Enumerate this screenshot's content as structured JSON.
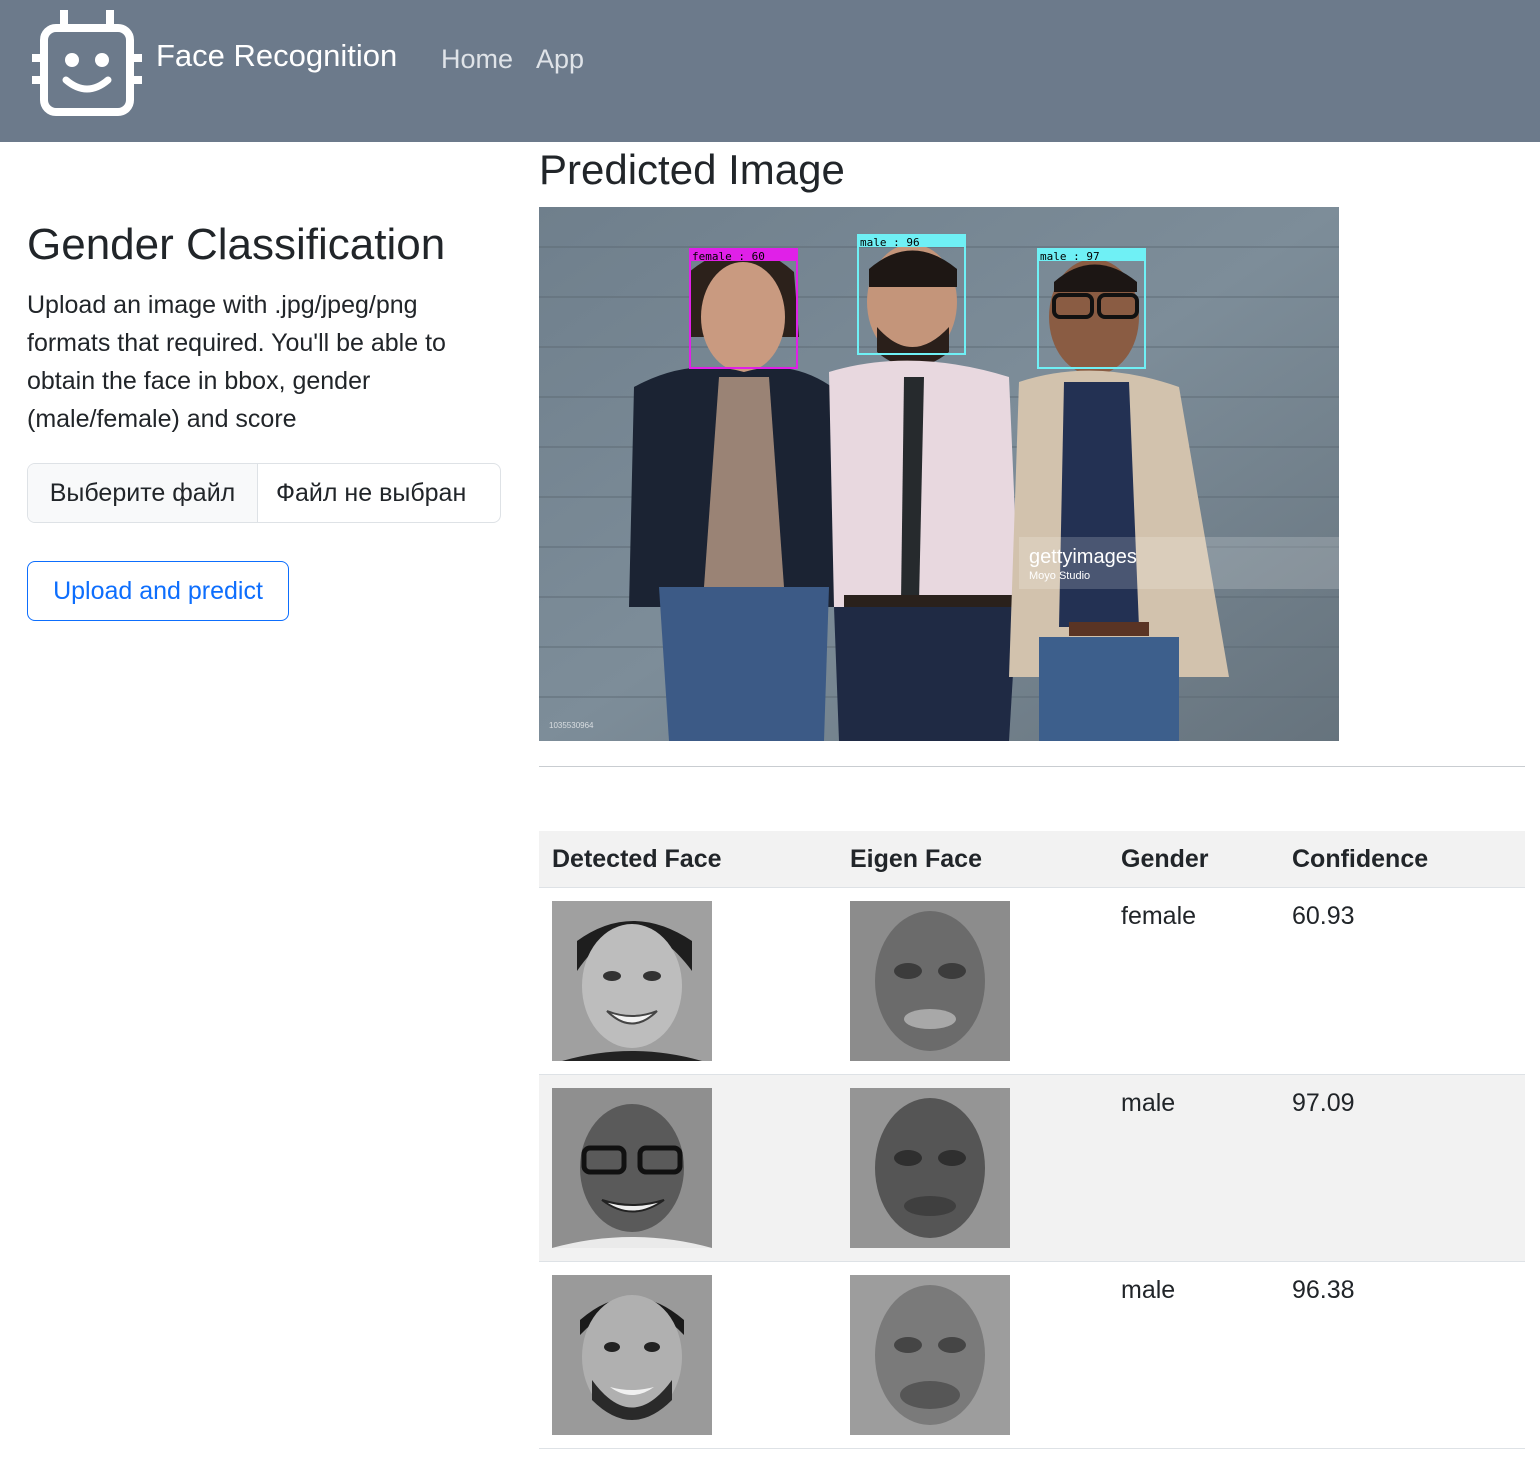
{
  "navbar": {
    "brand": "Face Recognition",
    "links": [
      "Home",
      "App"
    ],
    "logo_icon": "robot-face-icon"
  },
  "upload_panel": {
    "title": "Gender Classification",
    "description": "Upload an image with .jpg/jpeg/png formats that required. You'll be able to obtain the face in bbox, gender (male/female) and score",
    "file_button": "Выберите файл",
    "file_status": "Файл не выбран",
    "submit_button": "Upload and predict"
  },
  "prediction": {
    "title": "Predicted Image",
    "box_labels": [
      "female : 60",
      "male : 96",
      "male : 97"
    ],
    "watermark": "gettyimages",
    "watermark_credit": "Moyo Studio",
    "image_id": "1035530964"
  },
  "results": {
    "headers": [
      "Detected Face",
      "Eigen Face",
      "Gender",
      "Confidence"
    ],
    "rows": [
      {
        "gender": "female",
        "confidence": "60.93"
      },
      {
        "gender": "male",
        "confidence": "97.09"
      },
      {
        "gender": "male",
        "confidence": "96.38"
      }
    ]
  },
  "colors": {
    "navbar": "#6c7a8b",
    "primary": "#0d6efd",
    "female_box": "#e020e8",
    "male_box": "#6ff0f5"
  }
}
